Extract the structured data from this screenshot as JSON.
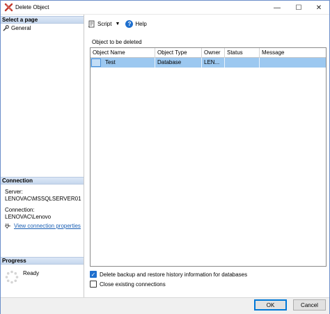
{
  "window": {
    "title": "Delete Object"
  },
  "titlebar": {
    "minimize": "—",
    "maximize": "☐",
    "close": "✕"
  },
  "left_pane": {
    "select_page_header": "Select a page",
    "nav_items": [
      {
        "label": "General",
        "icon": "wrench-icon"
      }
    ],
    "connection_header": "Connection",
    "server_label": "Server:",
    "server_value": "LENOVAC\\MSSQLSERVER01",
    "connection_label": "Connection:",
    "connection_value": "LENOVAC\\Lenovo",
    "view_connection_link": "View connection properties",
    "progress_header": "Progress",
    "progress_status": "Ready"
  },
  "toolbar": {
    "script_label": "Script",
    "help_label": "Help"
  },
  "main": {
    "objects_label": "Object to be deleted",
    "columns": [
      "Object Name",
      "Object Type",
      "Owner",
      "Status",
      "Message"
    ],
    "rows": [
      {
        "object_name": "Test",
        "object_type": "Database",
        "owner": "LEN...",
        "status": "",
        "message": ""
      }
    ],
    "delete_backup_label": "Delete backup and restore history information for databases",
    "delete_backup_checked": true,
    "close_connections_label": "Close existing connections",
    "close_connections_checked": false
  },
  "buttons": {
    "ok": "OK",
    "cancel": "Cancel"
  },
  "colors": {
    "accent": "#1e6fce",
    "selection": "#9cc8f0",
    "header_gradient": "#c7d8ee"
  }
}
